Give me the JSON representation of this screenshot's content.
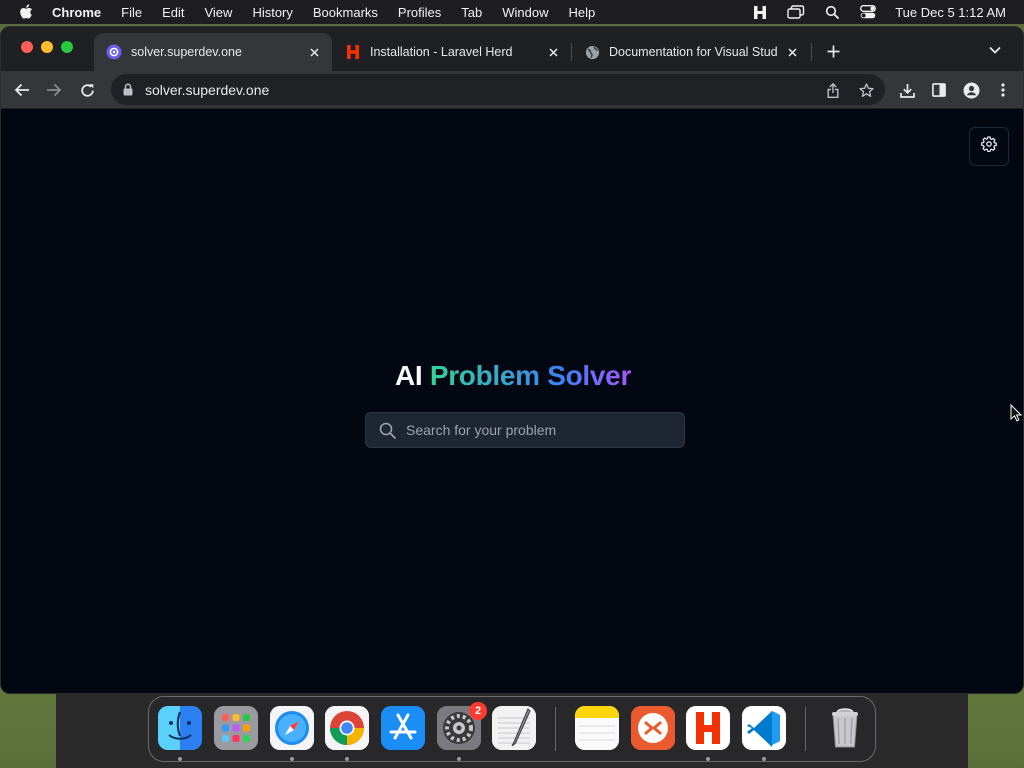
{
  "menubar": {
    "app_name": "Chrome",
    "items": [
      "File",
      "Edit",
      "View",
      "History",
      "Bookmarks",
      "Profiles",
      "Tab",
      "Window",
      "Help"
    ],
    "clock": "Tue Dec 5  1:12 AM"
  },
  "tabs": [
    {
      "label": "solver.superdev.one",
      "favicon": "solver-favicon",
      "active": true
    },
    {
      "label": "Installation - Laravel Herd",
      "favicon": "herd-favicon",
      "active": false
    },
    {
      "label": "Documentation for Visual Stud",
      "favicon": "globe-favicon",
      "active": false
    }
  ],
  "toolbar": {
    "url": "solver.superdev.one"
  },
  "page": {
    "title_plain": "AI",
    "title_gradient": "Problem Solver",
    "search_placeholder": "Search for your problem",
    "search_value": "",
    "gradient_colors": [
      "#34d399",
      "#3b82f6",
      "#a855f7"
    ]
  },
  "dock": {
    "apps": [
      "Finder",
      "Launchpad",
      "Safari",
      "Google Chrome",
      "App Store",
      "System Settings",
      "TextEdit",
      "Notes",
      "Remote Desktop",
      "Herd",
      "Visual Studio Code",
      "Trash"
    ],
    "settings_badge": "2"
  }
}
